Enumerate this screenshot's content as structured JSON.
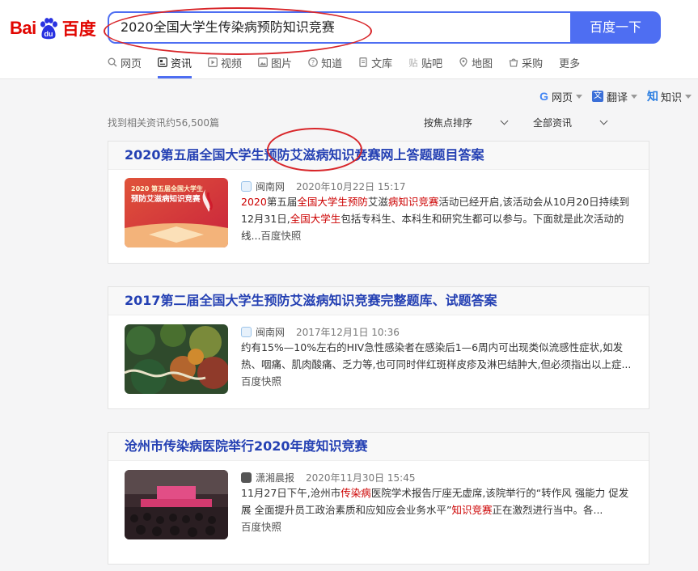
{
  "logo": {
    "part1": "Bai",
    "part2": "du",
    "part3": "百度"
  },
  "search": {
    "query": "2020全国大学生传染病预防知识竞赛",
    "button_label": "百度一下"
  },
  "nav_tabs": [
    {
      "label": "网页",
      "icon": "search-icon",
      "active": false
    },
    {
      "label": "资讯",
      "icon": "news-icon",
      "active": true
    },
    {
      "label": "视频",
      "icon": "video-icon",
      "active": false
    },
    {
      "label": "图片",
      "icon": "image-icon",
      "active": false
    },
    {
      "label": "知道",
      "icon": "question-icon",
      "active": false
    },
    {
      "label": "文库",
      "icon": "document-icon",
      "active": false
    },
    {
      "label": "贴吧",
      "icon": "tieba-icon",
      "active": false
    },
    {
      "label": "地图",
      "icon": "map-icon",
      "active": false
    },
    {
      "label": "采购",
      "icon": "shopping-icon",
      "active": false
    },
    {
      "label": "更多",
      "icon": "",
      "active": false
    }
  ],
  "tools": {
    "webpage": "网页",
    "translate": "翻译",
    "knowledge": "知识"
  },
  "results_meta": {
    "count_text": "找到相关资讯约56,500篇",
    "sort_label": "按焦点排序",
    "filter_label": "全部资讯"
  },
  "results": [
    {
      "title": "2020第五届全国大学生预防艾滋病知识竞赛网上答题题目答案",
      "source": "闽南网",
      "date": "2020年10月22日 15:17",
      "thumb_text": "2020 第五届全国大学生预防艾滋病知识竞赛",
      "abstract": [
        {
          "t": "2020",
          "hl": true
        },
        {
          "t": "第五届",
          "hl": false
        },
        {
          "t": "全国大学生预防",
          "hl": true
        },
        {
          "t": "艾滋",
          "hl": false
        },
        {
          "t": "病知识竞赛",
          "hl": true
        },
        {
          "t": "活动已经开启,该活动会从10月20日持续到12月31日,",
          "hl": false
        },
        {
          "t": "全国大学生",
          "hl": true
        },
        {
          "t": "包括专科生、本科生和研究生都可以参与。下面就是此次活动的线...",
          "hl": false
        }
      ],
      "snapshot": "百度快照"
    },
    {
      "title": "2017第二届全国大学生预防艾滋病知识竞赛完整题库、试题答案",
      "source": "闽南网",
      "date": "2017年12月1日 10:36",
      "thumb_text": "",
      "abstract": [
        {
          "t": "约有15%—10%左右的HIV急性感染者在感染后1—6周内可出现类似流感性症状,如发热、咽痛、肌肉酸痛、乏力等,也可同时伴红斑样皮疹及淋巴结肿大,但必须指出以上症...",
          "hl": false
        }
      ],
      "snapshot": "百度快照"
    },
    {
      "title": "沧州市传染病医院举行2020年度知识竞赛",
      "source": "潇湘晨报",
      "date": "2020年11月30日 15:45",
      "thumb_text": "",
      "abstract": [
        {
          "t": "11月27日下午,沧州市",
          "hl": false
        },
        {
          "t": "传染病",
          "hl": true
        },
        {
          "t": "医院学术报告厅座无虚席,该院举行的“转作风 强能力 促发展 全面提升员工政治素质和应知应会业务水平”",
          "hl": false
        },
        {
          "t": "知识竞赛",
          "hl": true
        },
        {
          "t": "正在激烈进行当中。各...",
          "hl": false
        }
      ],
      "snapshot": "百度快照"
    }
  ],
  "colors": {
    "accent": "#4e6ef2",
    "title": "#2440b3",
    "highlight": "#cc0000",
    "logo_red": "#e10601",
    "annotation": "#d8262a"
  }
}
